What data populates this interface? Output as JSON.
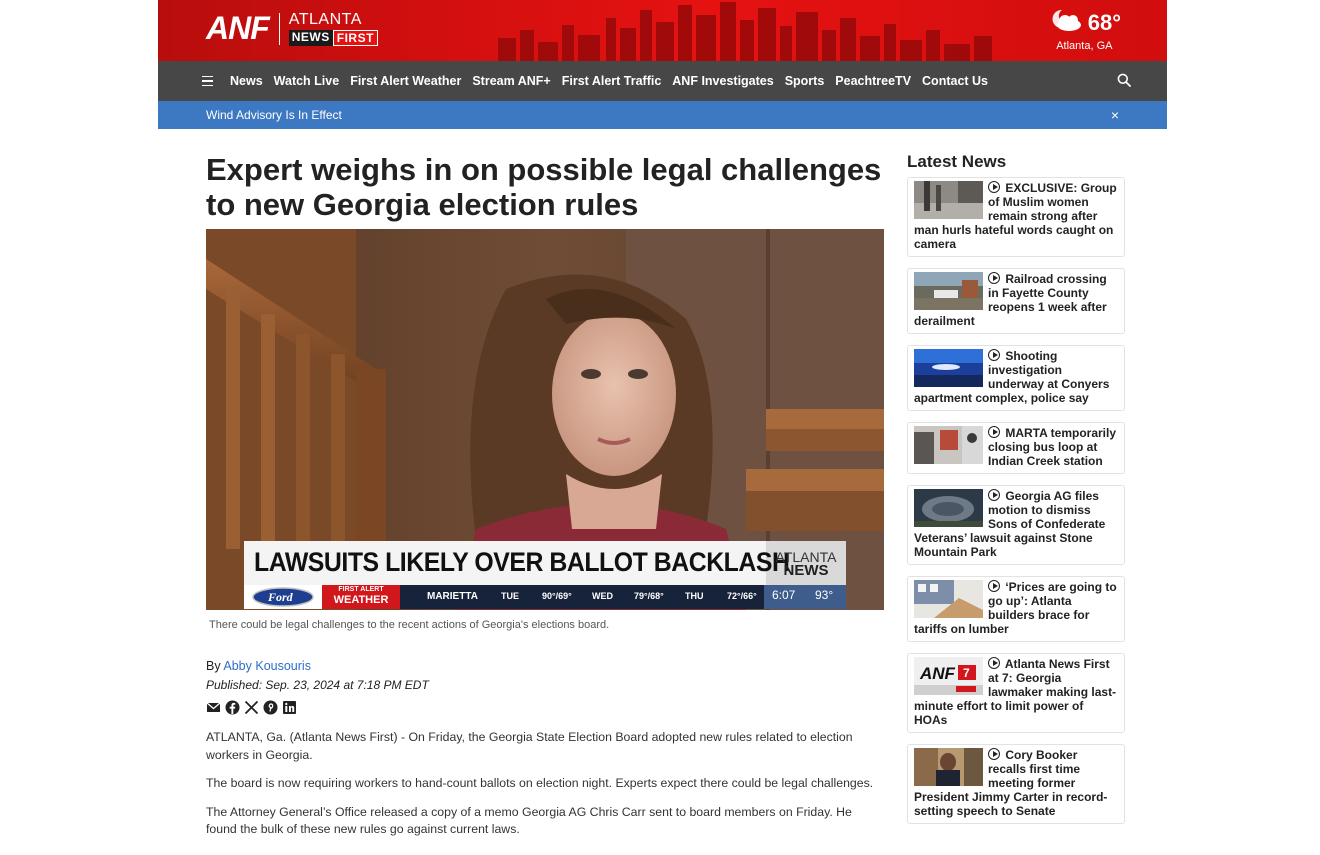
{
  "header": {
    "logo_anf": "ANF",
    "logo_atlanta": "ATLANTA",
    "logo_news": "NEWS",
    "logo_first": "FIRST",
    "weather_temp": "68°",
    "weather_location": "Atlanta, GA",
    "weather_icon": "partly-cloudy-night-icon"
  },
  "nav": {
    "items": [
      "News",
      "Watch Live",
      "First Alert Weather",
      "Stream ANF+",
      "First Alert Traffic",
      "ANF Investigates",
      "Sports",
      "PeachtreeTV",
      "Contact Us"
    ]
  },
  "alert": {
    "text": "Wind Advisory Is In Effect",
    "close": "×"
  },
  "article": {
    "headline": "Expert weighs in on possible legal challenges to new Georgia election rules",
    "video": {
      "lower_third": "LAWSUITS LIKELY OVER BALLOT BACKLASH",
      "bug_atlanta": "ATLANTA",
      "bug_news": "NEWS",
      "sponsor": "Ford",
      "weather_brand_1": "FIRST ALERT",
      "weather_brand_2": "WEATHER",
      "ticker_city": "MARIETTA",
      "forecast": [
        {
          "day": "TUE",
          "temps": "90°/69°"
        },
        {
          "day": "WED",
          "temps": "79°/68°"
        },
        {
          "day": "THU",
          "temps": "72°/66°"
        }
      ],
      "time": "6:07",
      "temp": "93°"
    },
    "caption": "There could be legal challenges to the recent actions of Georgia's elections board.",
    "by_prefix": "By",
    "author": "Abby Kousouris",
    "published": "Published: Sep. 23, 2024 at 7:18 PM EDT",
    "paragraphs": [
      "ATLANTA, Ga. (Atlanta News First) - On Friday, the Georgia State Election Board adopted new rules related to election workers in Georgia.",
      "The board is now requiring workers to hand-count ballots on election night. Experts expect there could be legal challenges.",
      "The Attorney General’s Office released a copy of a memo Georgia AG Chris Carr sent to board members on Friday. He found the bulk of these new rules go against current laws."
    ]
  },
  "sidebar": {
    "title": "Latest News",
    "items": [
      {
        "title": "EXCLUSIVE: Group of Muslim women remain strong after man hurls hateful words caught on camera"
      },
      {
        "title": "Railroad crossing in Fayette County reopens 1 week after derailment"
      },
      {
        "title": "Shooting investigation underway at Conyers apartment complex, police say"
      },
      {
        "title": "MARTA temporarily closing bus loop at Indian Creek station"
      },
      {
        "title": "Georgia AG files motion to dismiss Sons of Confederate Veterans’ lawsuit against Stone Mountain Park"
      },
      {
        "title": "‘Prices are going to go up’: Atlanta builders brace for tariffs on lumber"
      },
      {
        "title": "Atlanta News First at 7: Georgia lawmaker making last-minute effort to limit power of HOAs"
      },
      {
        "title": "Cory Booker recalls first time meeting former President Jimmy Carter in record-setting speech to Senate"
      }
    ]
  }
}
